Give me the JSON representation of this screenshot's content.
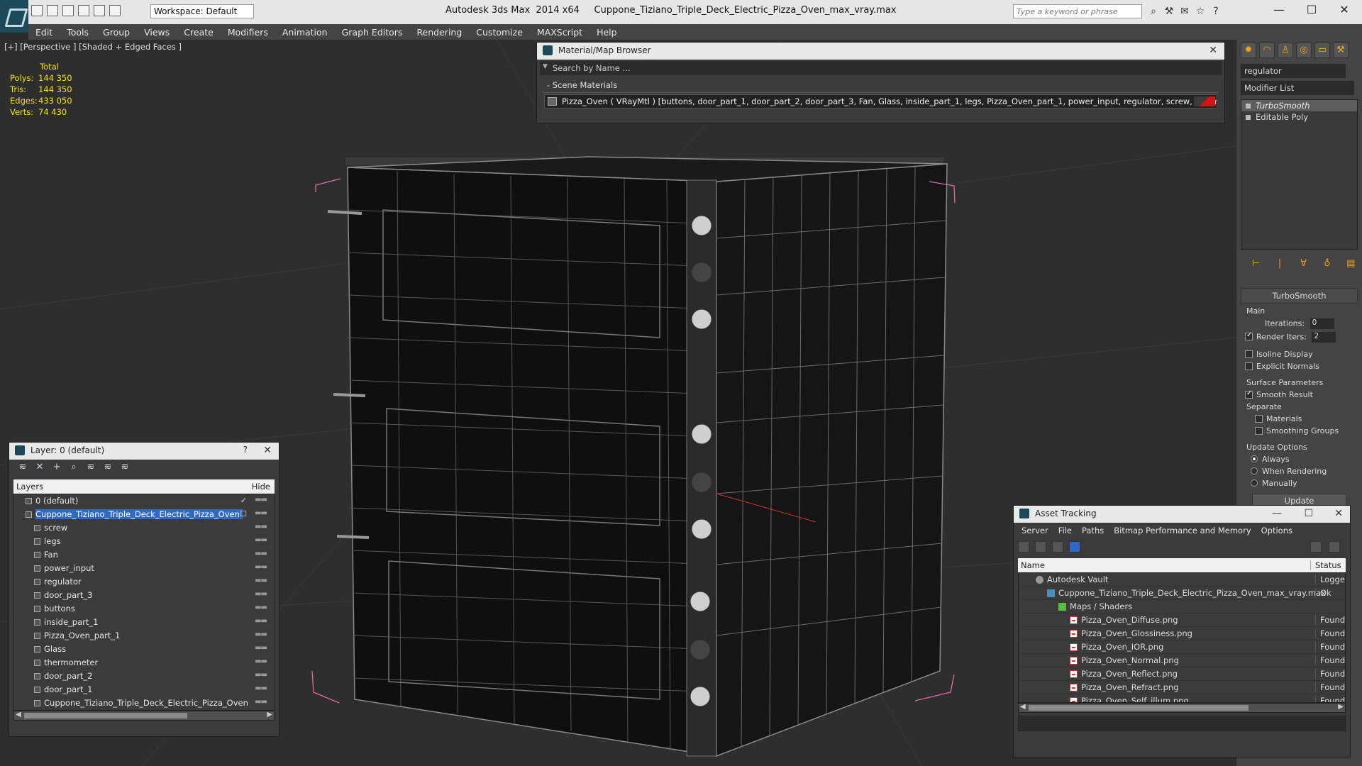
{
  "app": {
    "title": "Autodesk 3ds Max  2014 x64     Cuppone_Tiziano_Triple_Deck_Electric_Pizza_Oven_max_vray.max",
    "workspace": "Workspace: Default",
    "search_placeholder": "Type a keyword or phrase"
  },
  "menu": [
    "Edit",
    "Tools",
    "Group",
    "Views",
    "Create",
    "Modifiers",
    "Animation",
    "Graph Editors",
    "Rendering",
    "Customize",
    "MAXScript",
    "Help"
  ],
  "viewport": {
    "label": "[+] [Perspective ] [Shaded + Edged Faces ]",
    "stats": {
      "header": "Total",
      "rows": [
        {
          "label": "Polys:",
          "value": "144 350"
        },
        {
          "label": "Tris:",
          "value": "144 350"
        },
        {
          "label": "Edges:",
          "value": "433 050"
        },
        {
          "label": "Verts:",
          "value": "74 430"
        }
      ]
    }
  },
  "material_browser": {
    "title": "Material/Map Browser",
    "search_placeholder": "Search by Name ...",
    "section": "- Scene Materials",
    "material": "Pizza_Oven  ( VRayMtl )  [buttons, door_part_1, door_part_2, door_part_3, Fan, Glass, inside_part_1, legs, Pizza_Oven_part_1, power_input, regulator, screw, thermometer]"
  },
  "command_panel": {
    "object_name": "regulator",
    "modifier_list": "Modifier List",
    "stack": [
      "TurboSmooth",
      "Editable Poly"
    ],
    "rollout": "TurboSmooth",
    "main": "Main",
    "iterations_label": "Iterations:",
    "iterations_value": "0",
    "render_iters_label": "Render Iters:",
    "render_iters_value": "2",
    "isoline": "Isoline Display",
    "explicit_normals": "Explicit Normals",
    "surface_params": "Surface Parameters",
    "smooth_result": "Smooth Result",
    "separate": "Separate",
    "materials": "Materials",
    "smoothing_groups": "Smoothing Groups",
    "update_options": "Update Options",
    "always": "Always",
    "when_rendering": "When Rendering",
    "manually": "Manually",
    "update_button": "Update"
  },
  "layer_panel": {
    "title": "Layer: 0 (default)",
    "help": "?",
    "col_layers": "Layers",
    "col_hide": "Hide",
    "rows": [
      {
        "name": "0 (default)",
        "indent": 0
      },
      {
        "name": "Cuppone_Tiziano_Triple_Deck_Electric_Pizza_Oven",
        "indent": 0
      },
      {
        "name": "screw",
        "indent": 1
      },
      {
        "name": "legs",
        "indent": 1
      },
      {
        "name": "Fan",
        "indent": 1
      },
      {
        "name": "power_input",
        "indent": 1
      },
      {
        "name": "regulator",
        "indent": 1
      },
      {
        "name": "door_part_3",
        "indent": 1
      },
      {
        "name": "buttons",
        "indent": 1
      },
      {
        "name": "inside_part_1",
        "indent": 1
      },
      {
        "name": "Pizza_Oven_part_1",
        "indent": 1
      },
      {
        "name": "Glass",
        "indent": 1
      },
      {
        "name": "thermometer",
        "indent": 1
      },
      {
        "name": "door_part_2",
        "indent": 1
      },
      {
        "name": "door_part_1",
        "indent": 1
      },
      {
        "name": "Cuppone_Tiziano_Triple_Deck_Electric_Pizza_Oven",
        "indent": 1
      }
    ]
  },
  "asset_tracking": {
    "title": "Asset Tracking",
    "menu": [
      "Server",
      "File",
      "Paths",
      "Bitmap Performance and Memory",
      "Options"
    ],
    "col_name": "Name",
    "col_status": "Status",
    "rows": [
      {
        "name": "Autodesk Vault",
        "status": "Logged O",
        "indent": 1,
        "icon": "vault"
      },
      {
        "name": "Cuppone_Tiziano_Triple_Deck_Electric_Pizza_Oven_max_vray.max",
        "status": "Ok",
        "indent": 2,
        "icon": "max"
      },
      {
        "name": "Maps / Shaders",
        "status": "",
        "indent": 3,
        "icon": "folder"
      },
      {
        "name": "Pizza_Oven_Diffuse.png",
        "status": "Found",
        "indent": 4,
        "icon": "png"
      },
      {
        "name": "Pizza_Oven_Glossiness.png",
        "status": "Found",
        "indent": 4,
        "icon": "png"
      },
      {
        "name": "Pizza_Oven_IOR.png",
        "status": "Found",
        "indent": 4,
        "icon": "png"
      },
      {
        "name": "Pizza_Oven_Normal.png",
        "status": "Found",
        "indent": 4,
        "icon": "png"
      },
      {
        "name": "Pizza_Oven_Reflect.png",
        "status": "Found",
        "indent": 4,
        "icon": "png"
      },
      {
        "name": "Pizza_Oven_Refract.png",
        "status": "Found",
        "indent": 4,
        "icon": "png"
      },
      {
        "name": "Pizza_Oven_Self_illum.png",
        "status": "Found",
        "indent": 4,
        "icon": "png"
      }
    ]
  }
}
